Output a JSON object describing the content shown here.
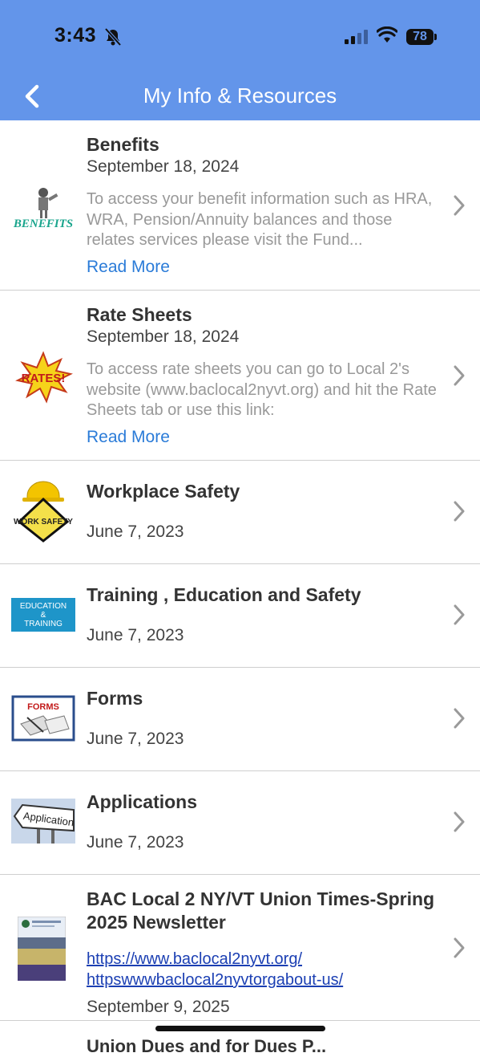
{
  "status_bar": {
    "time": "3:43",
    "battery": "78"
  },
  "header": {
    "title": "My Info & Resources"
  },
  "items": [
    {
      "title": "Benefits",
      "date": "September 18, 2024",
      "description": "To access your benefit information such as HRA, WRA, Pension/Annuity balances and those relates services please visit the Fund...",
      "read_more": "Read More",
      "thumb_text": "BENEFITS"
    },
    {
      "title": "Rate Sheets",
      "date": "September 18, 2024",
      "description": "To access rate sheets you can go to Local 2's website (www.baclocal2nyvt.org) and hit the Rate Sheets tab or use this link:",
      "read_more": "Read More",
      "thumb_text": "RATES!"
    },
    {
      "title": "Workplace Safety",
      "date": "June 7, 2023",
      "thumb_text": "WORK SAFETY"
    },
    {
      "title": "Training , Education and Safety",
      "date": "June 7, 2023",
      "thumb_text_1": "EDUCATION",
      "thumb_text_2": "&",
      "thumb_text_3": "TRAINING"
    },
    {
      "title": "Forms",
      "date": "June 7, 2023",
      "thumb_text": "FORMS"
    },
    {
      "title": "Applications",
      "date": "June 7, 2023",
      "thumb_text": "Application"
    },
    {
      "title": "BAC Local 2 NY/VT Union Times-Spring 2025 Newsletter",
      "link1": "https://www.baclocal2nyvt.org/",
      "link2": "httpswwwbaclocal2nyvtorgabout-us/",
      "date": "September 9, 2025"
    }
  ],
  "next_item_peek": "Union Dues and for Dues P..."
}
